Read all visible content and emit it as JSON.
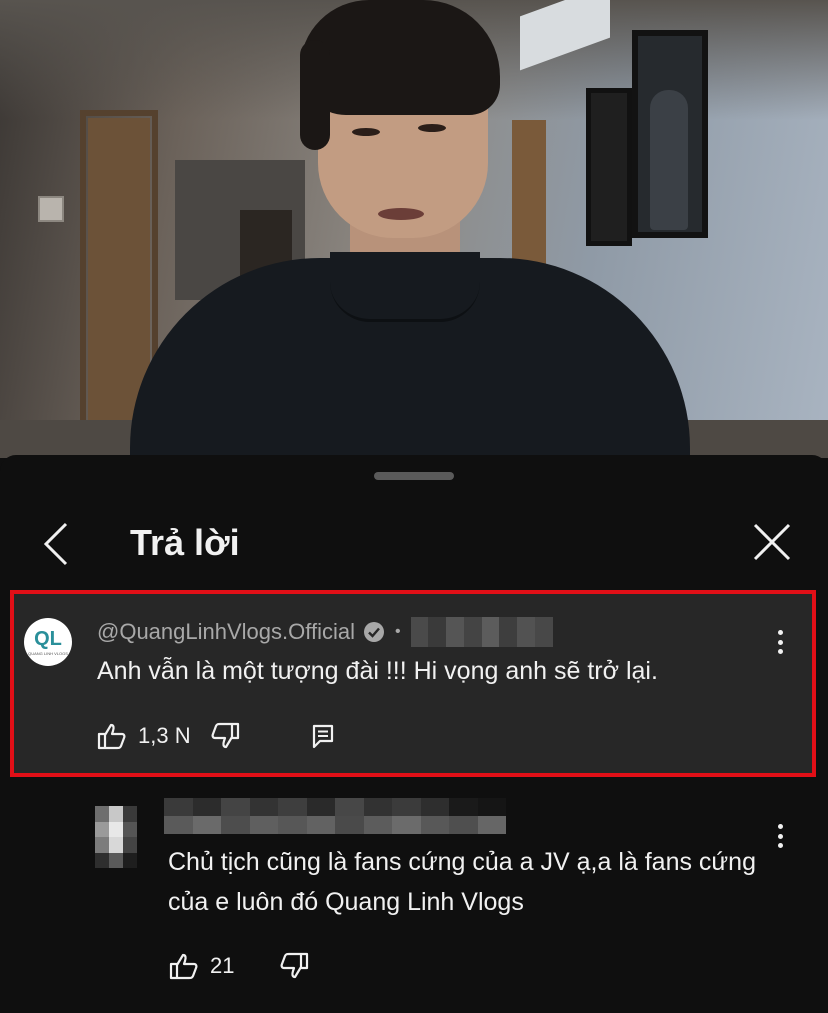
{
  "header": {
    "title": "Trả lời"
  },
  "main_comment": {
    "author": "@QuangLinhVlogs.Official",
    "avatar_text": "QL",
    "avatar_subtext": "QUANG LINH VLOGS",
    "separator": "•",
    "text": "Anh vẫn là một tượng đài !!! Hi vọng anh sẽ trở lại.",
    "likes": "1,3 N",
    "highlight_color": "#e10f17"
  },
  "reply": {
    "text": "Chủ tịch cũng là fans cứng của a JV ạ,a là fans cứng của e luôn đó Quang Linh Vlogs",
    "likes": "21"
  },
  "colors": {
    "background": "#0f0f0f",
    "highlighted_comment_bg": "#272727",
    "secondary_text": "#a8a8a8"
  },
  "icons": {
    "back": "chevron-left-icon",
    "close": "close-icon",
    "verified": "verified-check-icon",
    "more": "more-vertical-icon",
    "like": "thumbs-up-icon",
    "dislike": "thumbs-down-icon",
    "reply": "comment-icon"
  }
}
